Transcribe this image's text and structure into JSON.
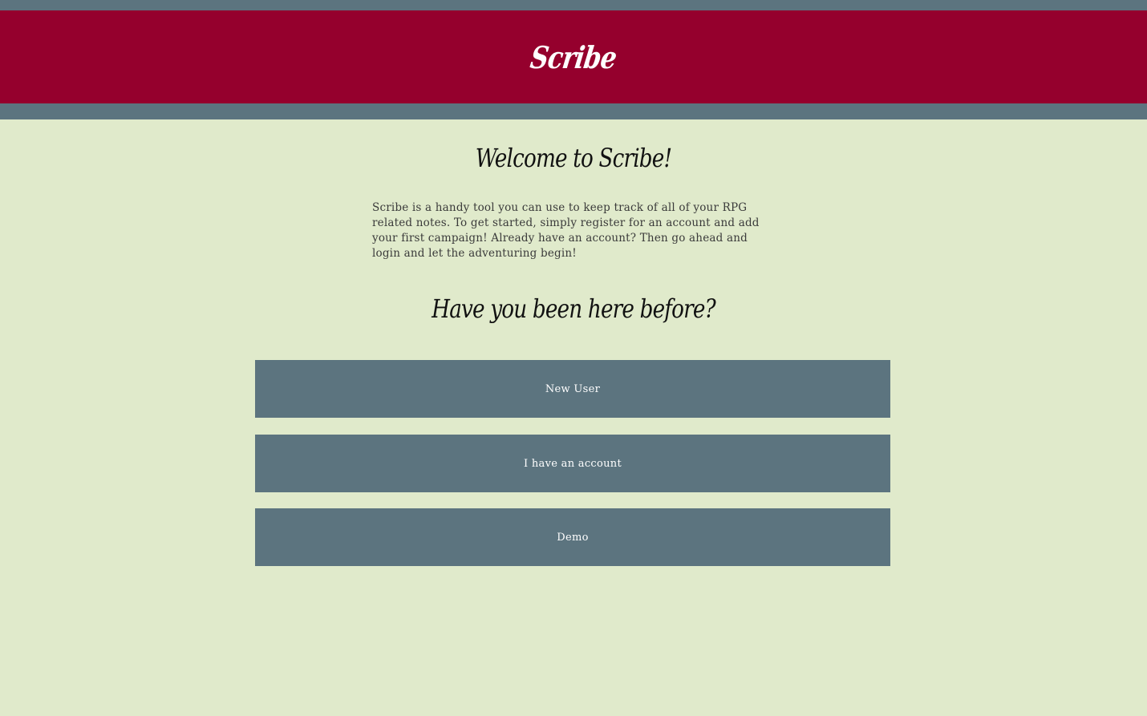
{
  "header": {
    "brand": "Scribe"
  },
  "main": {
    "welcome_title": "Welcome to Scribe!",
    "intro_text": "Scribe is a handy tool you can use to keep track of all of your RPG related notes. To get started, simply register for an account and add your first campaign! Already have an account? Then go ahead and login and let the adventuring begin!",
    "question": "Have you been here before?",
    "buttons": {
      "new_user": "New User",
      "have_account": "I have an account",
      "demo": "Demo"
    }
  },
  "colors": {
    "header_bg": "#95002d",
    "strip": "#5c747f",
    "page_bg": "#e0eacb",
    "button_bg": "#5c747f"
  }
}
